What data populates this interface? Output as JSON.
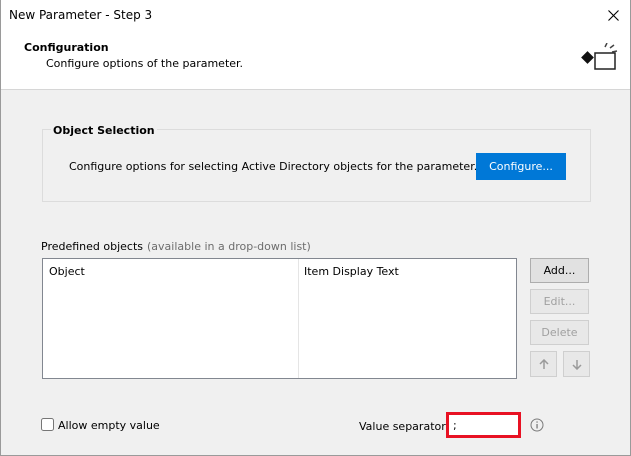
{
  "window": {
    "title": "New Parameter - Step 3",
    "close_icon": "close-icon"
  },
  "header": {
    "title": "Configuration",
    "subtitle": "Configure options of the parameter.",
    "icon": "wizard-icon"
  },
  "object_selection": {
    "title": "Object Selection",
    "description": "Configure options for selecting Active Directory objects for the parameter.",
    "configure_label": "Configure..."
  },
  "predefined": {
    "label": "Predefined objects",
    "note": "(available in a drop-down list)",
    "columns": [
      "Object",
      "Item Display Text"
    ],
    "rows": []
  },
  "buttons": {
    "add": "Add...",
    "edit": "Edit...",
    "delete": "Delete"
  },
  "allow_empty": {
    "label": "Allow empty value",
    "checked": false
  },
  "value_separator": {
    "label": "Value separator",
    "value": ";"
  },
  "colors": {
    "accent": "#0078d7",
    "highlight_border": "#e81123"
  }
}
